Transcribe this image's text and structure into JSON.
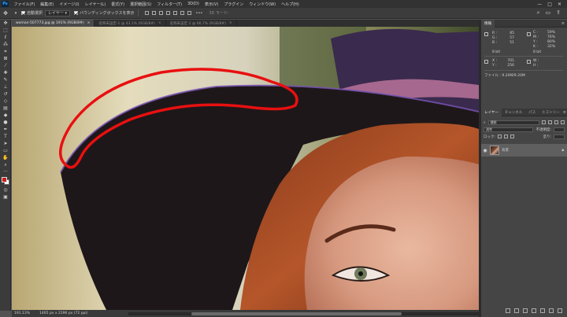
{
  "app": {
    "logo": "Ps"
  },
  "menu": [
    "ファイル(F)",
    "編集(E)",
    "イメージ(I)",
    "レイヤー(L)",
    "書式(Y)",
    "選択範囲(S)",
    "フィルター(T)",
    "3D(D)",
    "表示(V)",
    "プラグイン",
    "ウィンドウ(W)",
    "ヘルプ(H)"
  ],
  "window_controls": {
    "minimize": "—",
    "maximize": "□",
    "close": "✕"
  },
  "options": {
    "auto_select": "自動選択",
    "layer_dropdown": "レイヤー",
    "bounding_box": "バウンディングボックスを表示",
    "more": "•••",
    "mode_3d": "3D モード:"
  },
  "tabs": [
    {
      "label": "woman-507773.jpg @ 191% (RGB/8#)",
      "active": true
    },
    {
      "label": "名称未設定-1 @ 43.1% (RGB/8#)",
      "active": false
    },
    {
      "label": "名称未設定 2 @ 66.7% (RGB/8#)",
      "active": false
    }
  ],
  "status": {
    "zoom": "191.13%",
    "doc_size": "1465 px x 2196 px (72 ppi)"
  },
  "info_panel": {
    "tab": "情報",
    "rgb": [
      {
        "label": "R :",
        "value": "85"
      },
      {
        "label": "G :",
        "value": "57"
      },
      {
        "label": "B :",
        "value": "51"
      }
    ],
    "cmyk": [
      {
        "label": "C :",
        "value": "59%"
      },
      {
        "label": "M :",
        "value": "76%"
      },
      {
        "label": "Y :",
        "value": "80%"
      },
      {
        "label": "K :",
        "value": "32%"
      }
    ],
    "bit_left": "8 bit",
    "bit_right": "8 bit",
    "xy": [
      {
        "label": "X :",
        "value": "701"
      },
      {
        "label": "Y :",
        "value": "256"
      }
    ],
    "wh": [
      {
        "label": "W :",
        "value": ""
      },
      {
        "label": "H :",
        "value": ""
      }
    ],
    "file": "ファイル : 9.20M/9.20M"
  },
  "layers_panel": {
    "tabs": [
      "レイヤー",
      "チャンネル",
      "パス",
      "ヒストリー"
    ],
    "filter_label": "種類",
    "blend_mode": "通常",
    "opacity_label": "不透明度:",
    "lock_label": "ロック:",
    "fill_label": "塗り:",
    "layer_name": "背景",
    "bottom_icons": [
      "link-icon",
      "fx-icon",
      "mask-icon",
      "adjustment-icon",
      "folder-icon",
      "new-layer-icon",
      "trash-icon"
    ]
  },
  "colors": {
    "annotation": "#e81010",
    "foreground": "#c81d1d",
    "background_swatch": "#ffffff"
  }
}
